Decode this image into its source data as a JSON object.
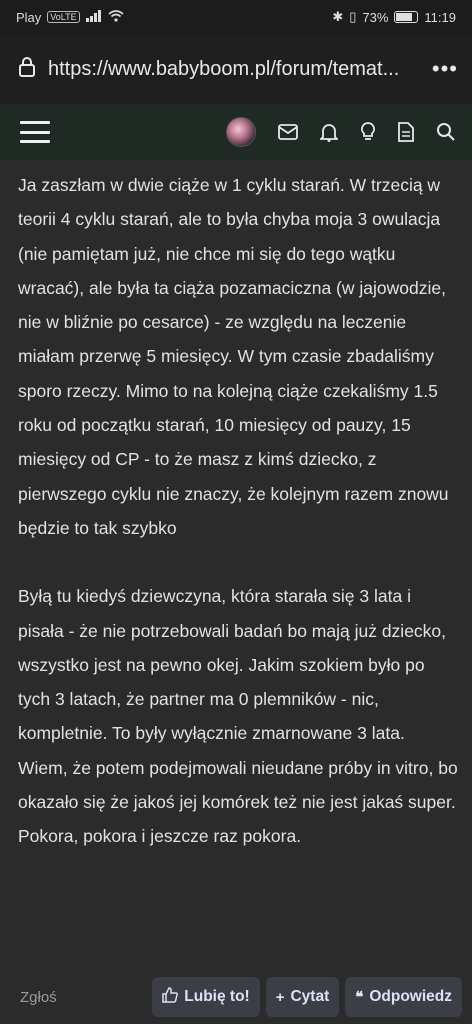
{
  "status_bar": {
    "carrier": "Play",
    "volte": "VoLTE",
    "battery": "73%",
    "time": "11:19"
  },
  "browser": {
    "url": "https://www.babyboom.pl/forum/temat..."
  },
  "post": {
    "paragraphs": [
      "Ja zaszłam w dwie ciąże w 1 cyklu starań. W trzecią w teorii 4 cyklu starań, ale to była chyba moja 3 owulacja (nie pamiętam już, nie chce mi się do tego wątku wracać), ale była ta ciąża pozamaciczna (w jajowodzie, nie w bliźnie po cesarce) - ze względu na leczenie miałam przerwę 5 miesięcy. W tym czasie zbadaliśmy sporo rzeczy. Mimo to na kolejną ciąże czekaliśmy 1.5 roku od początku starań, 10 miesięcy od pauzy, 15 miesięcy od CP - to że masz z kimś dziecko, z pierwszego cyklu nie znaczy, że kolejnym razem znowu będzie to tak szybko",
      "Byłą tu kiedyś dziewczyna, która starała się 3 lata i pisała - że nie potrzebowali badań bo mają już dziecko, wszystko jest na pewno okej. Jakim szokiem było po tych 3 latach, że partner ma 0 plemników - nic, kompletnie. To były wyłącznie zmarnowane 3 lata. Wiem, że potem podejmowali nieudane próby in vitro, bo okazało się że jakoś jej komórek też nie jest jakaś super. Pokora, pokora i jeszcze raz pokora."
    ]
  },
  "actions": {
    "report": "Zgłoś",
    "like": "Lubię to!",
    "follow": "Cytat",
    "reply": "Odpowiedz"
  },
  "icons": [
    "lock-icon",
    "more-icon",
    "hamburger-icon",
    "avatar",
    "mail-icon",
    "bell-icon",
    "lightbulb-icon",
    "document-icon",
    "search-icon",
    "thumbs-up-icon",
    "plus-icon",
    "quote-icon"
  ]
}
